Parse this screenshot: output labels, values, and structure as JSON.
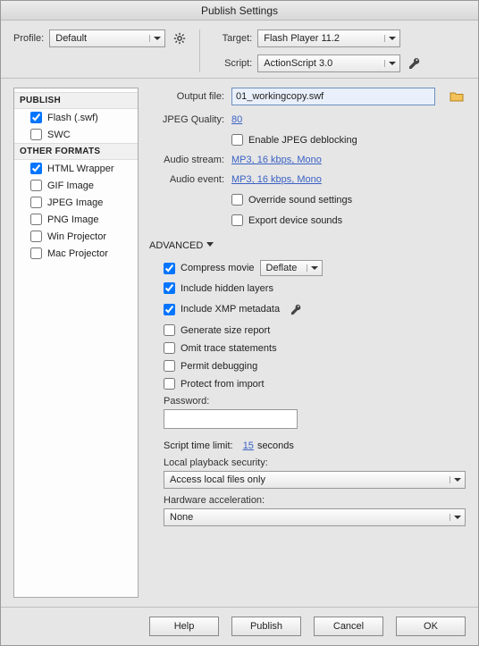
{
  "title": "Publish Settings",
  "profile": {
    "label": "Profile:",
    "value": "Default"
  },
  "target": {
    "label": "Target:",
    "value": "Flash Player 11.2"
  },
  "script": {
    "label": "Script:",
    "value": "ActionScript 3.0"
  },
  "sidebar": {
    "header_publish": "PUBLISH",
    "header_other": "OTHER FORMATS",
    "items_publish": [
      {
        "label": "Flash (.swf)",
        "checked": true
      },
      {
        "label": "SWC",
        "checked": false
      }
    ],
    "items_other": [
      {
        "label": "HTML Wrapper",
        "checked": true
      },
      {
        "label": "GIF Image",
        "checked": false
      },
      {
        "label": "JPEG Image",
        "checked": false
      },
      {
        "label": "PNG Image",
        "checked": false
      },
      {
        "label": "Win Projector",
        "checked": false
      },
      {
        "label": "Mac Projector",
        "checked": false
      }
    ]
  },
  "output": {
    "label": "Output file:",
    "value": "01_workingcopy.swf"
  },
  "jpeg": {
    "label": "JPEG Quality:",
    "value": "80",
    "deblock_label": "Enable JPEG deblocking",
    "deblock_checked": false
  },
  "audio_stream": {
    "label": "Audio stream:",
    "value": "MP3, 16 kbps, Mono"
  },
  "audio_event": {
    "label": "Audio event:",
    "value": "MP3, 16 kbps, Mono",
    "override_label": "Override sound settings",
    "override_checked": false,
    "export_label": "Export device sounds",
    "export_checked": false
  },
  "advanced": {
    "header": "ADVANCED",
    "compress": {
      "label": "Compress movie",
      "checked": true,
      "value": "Deflate"
    },
    "hidden_layers": {
      "label": "Include hidden layers",
      "checked": true
    },
    "xmp": {
      "label": "Include XMP metadata",
      "checked": true
    },
    "size_report": {
      "label": "Generate size report",
      "checked": false
    },
    "omit_trace": {
      "label": "Omit trace statements",
      "checked": false
    },
    "permit_debug": {
      "label": "Permit debugging",
      "checked": false
    },
    "protect_import": {
      "label": "Protect from import",
      "checked": false
    },
    "password_label": "Password:",
    "script_time": {
      "pre": "Script time limit:",
      "value": "15",
      "post": "seconds"
    },
    "local_playback": {
      "label": "Local playback security:",
      "value": "Access local files only"
    },
    "hw_accel": {
      "label": "Hardware acceleration:",
      "value": "None"
    }
  },
  "buttons": {
    "help": "Help",
    "publish": "Publish",
    "cancel": "Cancel",
    "ok": "OK"
  }
}
